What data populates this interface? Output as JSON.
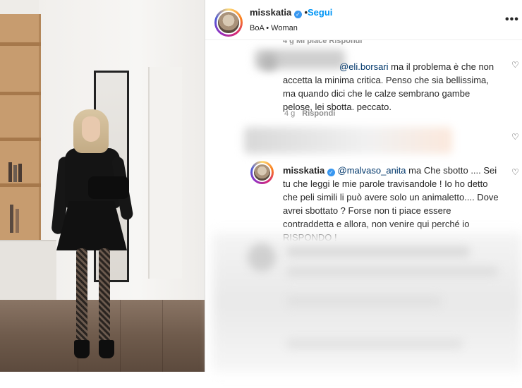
{
  "post": {
    "username": "misskatia",
    "follow_label": "Segui",
    "subtitle": "BoA • Woman",
    "more_icon": "more-icon"
  },
  "top_meta": "4 g   Mi piace   Rispondi",
  "comments": [
    {
      "mention": "@eli.borsari",
      "text": " ma il problema è che non accetta la minima critica. Penso che sia bellissima, ma quando dici che le calze sembrano gambe pelose, lei sbotta. peccato.",
      "time": "4 g",
      "reply_label": "Rispondi"
    },
    {
      "username": "misskatia",
      "mention": "@malvaso_anita",
      "text": " ma Che sbotto .... Sei tu che leggi le mie parole travisandole ! Io ho detto che peli simili li può avere solo un animaletto.... Dove avrei sbottato ? Forse non ti piace essere contraddetta e allora, non venire qui perché io RISPONDO !"
    }
  ],
  "colors": {
    "follow": "#0095f6",
    "mention": "#00376b",
    "meta": "#8e8e8e",
    "verified": "#3897f0"
  }
}
